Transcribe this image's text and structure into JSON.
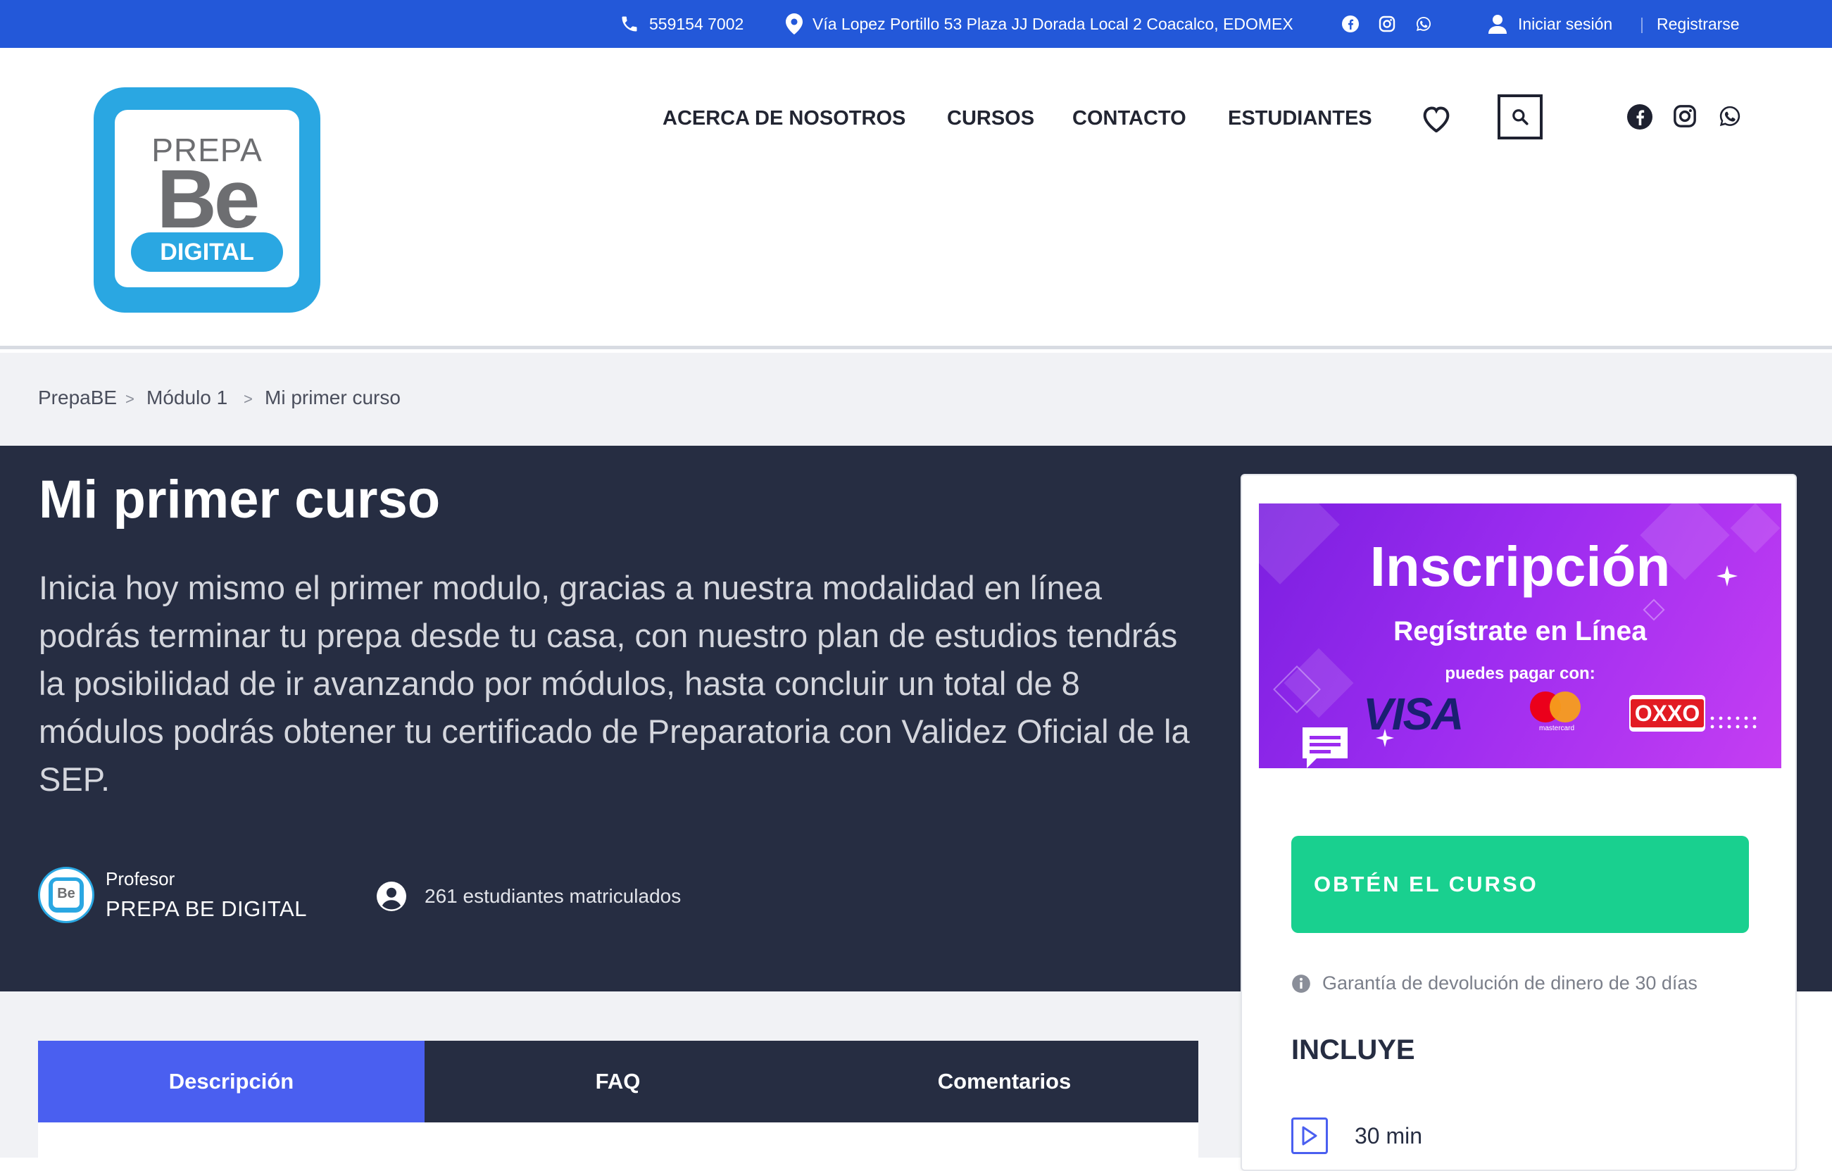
{
  "topbar": {
    "phone": "559154 7002",
    "address": "Vía Lopez Portillo 53 Plaza JJ Dorada Local 2 Coacalco, EDOMEX",
    "social_icons": [
      "facebook-icon",
      "instagram-icon",
      "whatsapp-icon"
    ],
    "login": "Iniciar sesión",
    "register": "Registrarse",
    "bg_color": "#2358d9"
  },
  "logo": {
    "line1": "PREPA",
    "line2": "Be",
    "line3": "DIGITAL"
  },
  "nav": {
    "items": [
      "ACERCA DE NOSOTROS",
      "CURSOS",
      "CONTACTO",
      "ESTUDIANTES"
    ],
    "icons": [
      "heart-icon",
      "search-icon",
      "facebook-icon",
      "instagram-icon",
      "whatsapp-icon"
    ]
  },
  "breadcrumb": {
    "items": [
      "PrepaBE",
      "Módulo 1",
      "Mi primer curso"
    ],
    "separator": ">"
  },
  "course": {
    "title": "Mi primer curso",
    "description": "Inicia hoy mismo el primer modulo, gracias a nuestra modalidad en línea podrás terminar tu prepa desde tu casa, con nuestro plan de estudios tendrás la posibilidad de ir avanzando por módulos, hasta concluir un total de 8 módulos podrás obtener tu certificado de Preparatoria con Validez Oficial de la SEP.",
    "teacher_label": "Profesor",
    "teacher_name": "PREPA BE DIGITAL",
    "avatar_text": "Be",
    "students": "261 estudiantes matriculados"
  },
  "tabs": [
    "Descripción",
    "FAQ",
    "Comentarios"
  ],
  "sidebar": {
    "banner_title": "Inscripción",
    "banner_subtitle": "Regístrate en Línea",
    "banner_pay": "puedes pagar con:",
    "visa": "VISA",
    "mastercard": "mastercard",
    "oxxo": "OXXO",
    "button": "OBTÉN EL CURSO",
    "guarantee": "Garantía de devolución de dinero de 30 días",
    "includes_title": "INCLUYE",
    "includes": [
      {
        "icon": "play-icon",
        "label": "30 min"
      }
    ],
    "button_color": "#19d08f",
    "accent_color": "#4a5ff0"
  },
  "colors": {
    "hero_bg": "#262d42",
    "page_bg": "#f1f2f5"
  }
}
